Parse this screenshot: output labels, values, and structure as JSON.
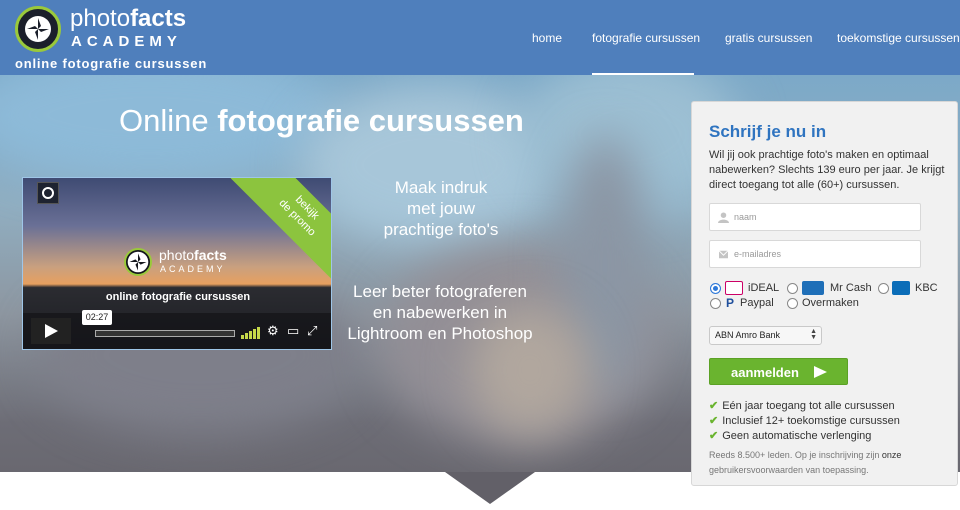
{
  "brand": {
    "name_light": "photo",
    "name_bold": "facts",
    "academy": "ACADEMY",
    "tagline": "online fotografie cursussen"
  },
  "nav": {
    "items": [
      {
        "label": "home"
      },
      {
        "label": "fotografie cursussen",
        "active": true
      },
      {
        "label": "gratis cursussen"
      },
      {
        "label": "toekomstige cursussen"
      }
    ]
  },
  "hero": {
    "title_light": "Online",
    "title_bold": "fotografie cursussen",
    "text_1": [
      "Maak indruk",
      "met jouw",
      "prachtige foto's"
    ],
    "text_2": [
      "Leer beter fotograferen",
      "en nabewerken in",
      "Lightroom en Photoshop"
    ]
  },
  "video": {
    "ribbon": [
      "bekijk",
      "de promo"
    ],
    "logo_light": "photo",
    "logo_bold": "facts",
    "logo_academy": "ACADEMY",
    "caption": "online fotografie cursussen",
    "time": "02:27",
    "progress": 0
  },
  "signup": {
    "title": "Schrijf je nu in",
    "description": "Wil jij ook prachtige foto's maken en optimaal nabewerken? Slechts 139 euro per jaar. Je krijgt direct toegang tot alle (60+) cursussen.",
    "name_placeholder": "naam",
    "email_placeholder": "e-mailadres",
    "payment_methods": [
      {
        "label": "iDEAL",
        "selected": true
      },
      {
        "label": "Mr Cash",
        "selected": false
      },
      {
        "label": "KBC",
        "selected": false
      },
      {
        "label": "Paypal",
        "selected": false
      },
      {
        "label": "Overmaken",
        "selected": false
      }
    ],
    "bank": "ABN Amro Bank",
    "submit": "aanmelden",
    "benefits": [
      "Eén jaar toegang tot alle cursussen",
      "Inclusief 12+ toekomstige cursussen",
      "Geen automatische verlenging"
    ],
    "fineprint_a": "Reeds 8.500+ leden. Op je inschrijving zijn",
    "fineprint_b": "onze",
    "fineprint_c": "gebruikersvoorwaarden",
    "fineprint_d": "van toepassing."
  },
  "colors": {
    "header": "#4f7fbc",
    "accent_green": "#6ab42f",
    "link_blue": "#2f74c0"
  }
}
